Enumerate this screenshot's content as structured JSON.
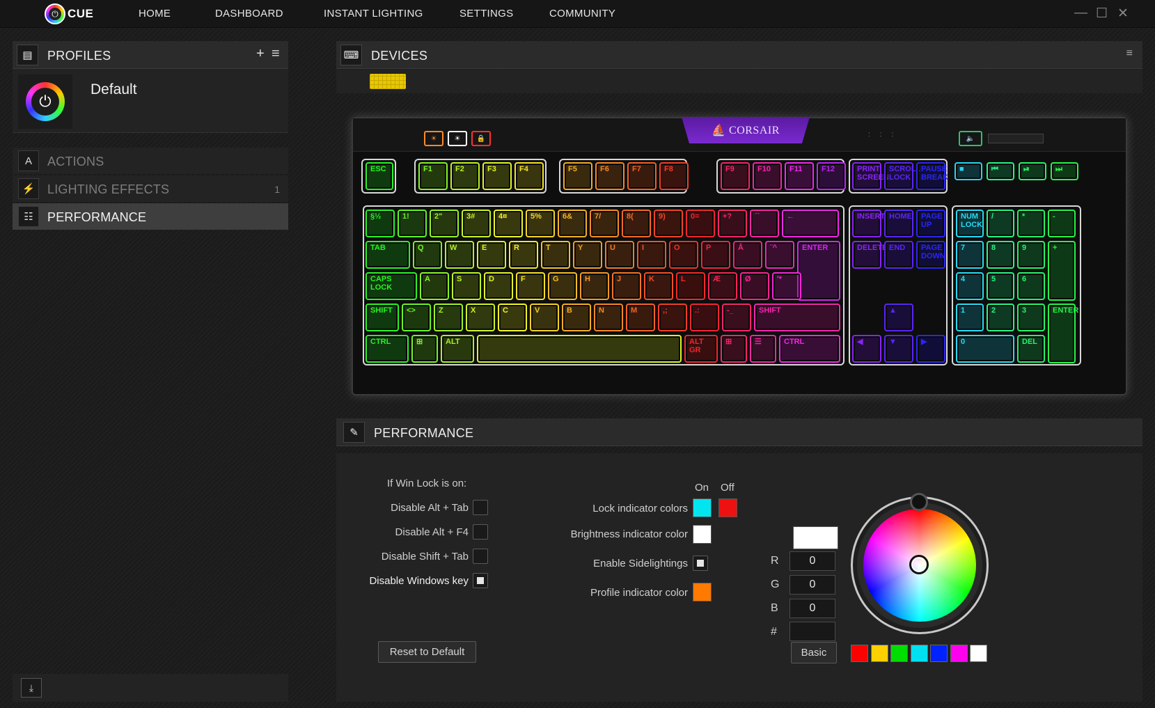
{
  "app": {
    "logo_text": "CUE"
  },
  "nav": [
    "HOME",
    "DASHBOARD",
    "INSTANT LIGHTING",
    "SETTINGS",
    "COMMUNITY"
  ],
  "window_controls": {
    "minimize": "—",
    "maximize": "☐",
    "close": "✕"
  },
  "profiles": {
    "title": "PROFILES",
    "add": "+",
    "menu": "≡",
    "default_name": "Default"
  },
  "menu": {
    "actions": "ACTIONS",
    "lighting": "LIGHTING EFFECTS",
    "lighting_count": "1",
    "performance": "PERFORMANCE"
  },
  "devices": {
    "title": "DEVICES",
    "brand": "⛵ CORSAIR"
  },
  "keyboard": {
    "esc": "ESC",
    "f": [
      "F1",
      "F2",
      "F3",
      "F4",
      "F5",
      "F6",
      "F7",
      "F8",
      "F9",
      "F10",
      "F11",
      "F12"
    ],
    "nav_top": [
      "PRINT SCREEN",
      "SCROLL LOCK",
      "PAUSE BREAK"
    ],
    "num_row": [
      "§½",
      "1!",
      "2\"",
      "3#",
      "4¤",
      "5%",
      "6&",
      "7/",
      "8(",
      "9)",
      "0=",
      "+?",
      "´`",
      "←"
    ],
    "q_row": [
      "TAB",
      "Q",
      "W",
      "E",
      "R",
      "T",
      "Y",
      "U",
      "I",
      "O",
      "P",
      "Å",
      "¨^",
      "ENTER"
    ],
    "a_row": [
      "CAPS LOCK",
      "A",
      "S",
      "D",
      "F",
      "G",
      "H",
      "J",
      "K",
      "L",
      "Æ",
      "Ø",
      "'*"
    ],
    "z_row": [
      "SHIFT",
      "<>",
      "Z",
      "X",
      "C",
      "V",
      "B",
      "N",
      "M",
      ",;",
      ".:",
      "-_",
      "SHIFT"
    ],
    "bottom": [
      "CTRL",
      "⊞",
      "ALT",
      "",
      "ALT GR",
      "⊞",
      "☰",
      "CTRL"
    ],
    "ins_row": [
      "INSERT",
      "HOME",
      "PAGE UP"
    ],
    "del_row": [
      "DELETE",
      "END",
      "PAGE DOWN"
    ],
    "arrows": [
      "▲",
      "◀",
      "▼",
      "▶"
    ],
    "numpad": [
      "NUM LOCK",
      "/",
      "*",
      "-",
      "7",
      "8",
      "9",
      "+",
      "4",
      "5",
      "6",
      "1",
      "2",
      "3",
      "ENTER",
      "0",
      "DEL"
    ],
    "media": [
      "■",
      "⏮",
      "⏯",
      "⏭"
    ],
    "mini": [
      "☀",
      "☀",
      "🔒"
    ],
    "vol": "🔈"
  },
  "performance": {
    "title": "PERFORMANCE",
    "winlock_heading": "If Win Lock is on:",
    "disable_alt_tab": "Disable Alt + Tab",
    "disable_alt_f4": "Disable Alt + F4",
    "disable_shift_tab": "Disable Shift + Tab",
    "disable_win_key": "Disable Windows key",
    "on": "On",
    "off": "Off",
    "lock_indicator": "Lock indicator colors",
    "brightness_indicator": "Brightness indicator color",
    "sidelights": "Enable Sidelightings",
    "profile_indicator": "Profile indicator color",
    "reset": "Reset to Default",
    "r_label": "R",
    "g_label": "G",
    "b_label": "B",
    "hex_label": "#",
    "r": "0",
    "g": "0",
    "b": "0",
    "hex": "",
    "basic": "Basic",
    "colors": {
      "lock_on": "#00e5f0",
      "lock_off": "#ee1111",
      "brightness": "#ffffff",
      "profile": "#ff7a00",
      "preview": "#ffffff"
    },
    "checks": {
      "alt_tab": false,
      "alt_f4": false,
      "shift_tab": false,
      "win_key": true,
      "sidelights": true
    },
    "presets": [
      "#ff0000",
      "#ffd000",
      "#00dd00",
      "#00e0f0",
      "#0022ff",
      "#ff00ee",
      "#ffffff"
    ]
  }
}
